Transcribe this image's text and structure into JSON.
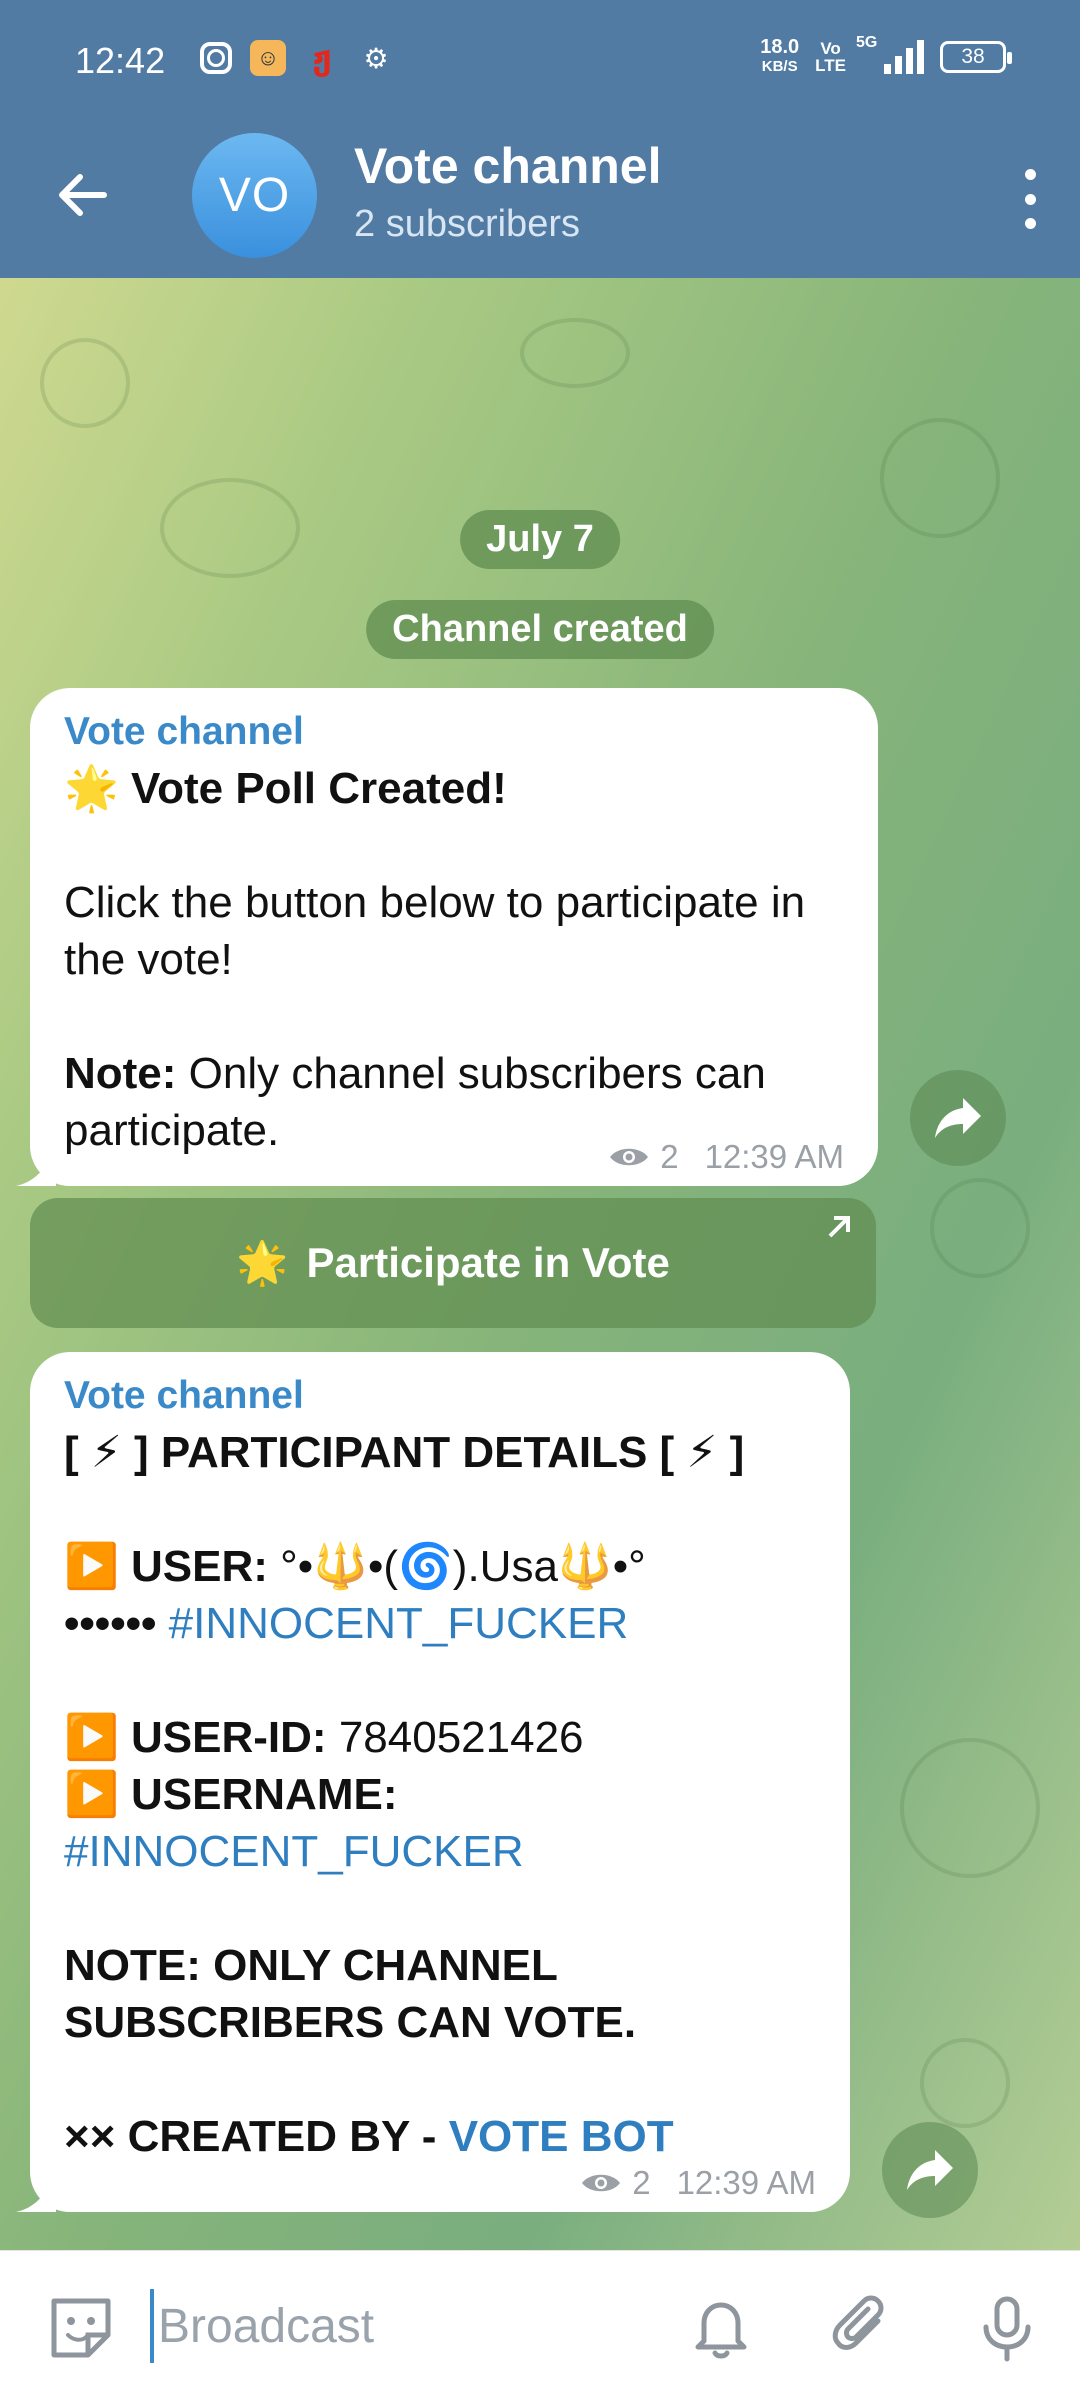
{
  "status_bar": {
    "time": "12:42",
    "net_speed_value": "18.0",
    "net_speed_unit": "KB/S",
    "volte_top": "Vo",
    "volte_bottom": "LTE",
    "network": "5G",
    "battery": "38"
  },
  "header": {
    "avatar_initials": "VO",
    "title": "Vote channel",
    "subtitle": "2 subscribers"
  },
  "chat": {
    "date_pill": "July 7",
    "service_message": "Channel created",
    "message1": {
      "sender": "Vote channel",
      "line1_emoji": "🌟",
      "line1_text": "Vote Poll Created!",
      "line2": "Click the button below to participate in the vote!",
      "note_label": "Note:",
      "note_text": " Only channel subscribers can participate.",
      "views": "2",
      "time": "12:39 AM"
    },
    "inline_button": {
      "emoji": "🌟",
      "label": "Participate in Vote"
    },
    "message2": {
      "sender": "Vote channel",
      "heading_left": "[ ",
      "heading_emoji": "⚡",
      "heading_mid": " ] PARTICIPANT DETAILS [ ",
      "heading_right": " ]",
      "play_emoji": "▶️",
      "user_label": "USER:",
      "user_value": " °•🔱•(🌀).Usa🔱•°",
      "user_line2_prefix": "•••••• ",
      "user_hashtag": "#INNOCENT_FUCKER",
      "userid_label": "USER-ID:",
      "userid_value": " 7840521426",
      "username_label": "USERNAME:",
      "username_hashtag": "#INNOCENT_FUCKER",
      "note_line1": "NOTE: ONLY CHANNEL",
      "note_line2": "SUBSCRIBERS CAN VOTE.",
      "created_prefix": "×× CREATED BY - ",
      "created_link": "VOTE BOT",
      "views": "2",
      "time": "12:39 AM"
    }
  },
  "input_bar": {
    "placeholder": "Broadcast"
  },
  "colors": {
    "header": "#517ba3",
    "accent": "#3a89c9",
    "link": "#2f7fc0"
  }
}
